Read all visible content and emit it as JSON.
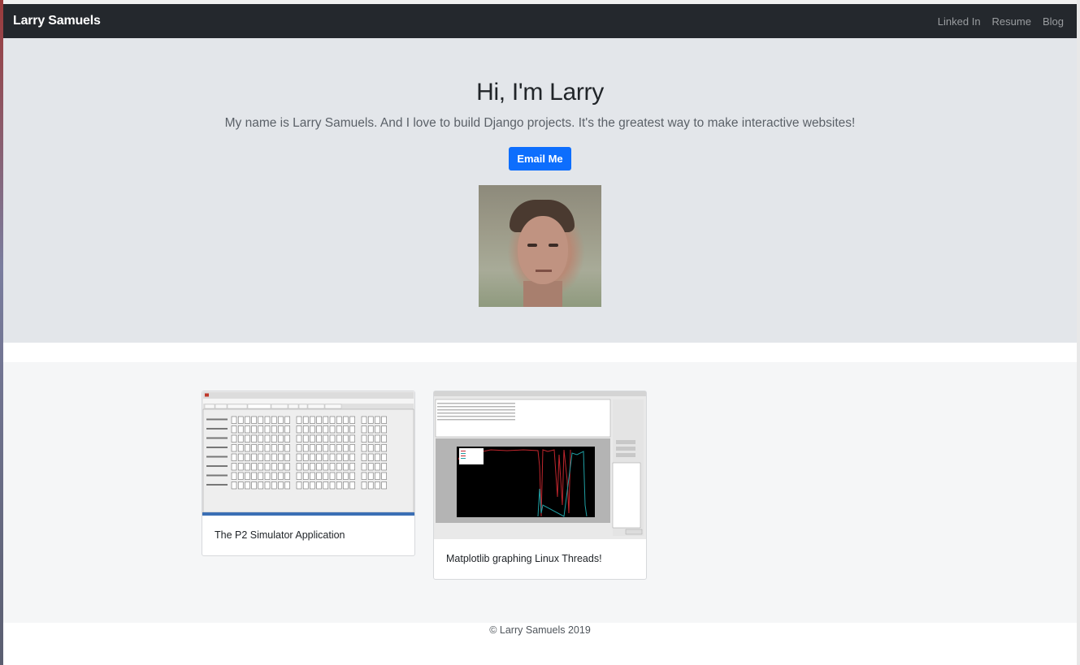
{
  "navbar": {
    "brand": "Larry Samuels",
    "links": [
      "Linked In",
      "Resume",
      "Blog"
    ]
  },
  "hero": {
    "heading": "Hi, I'm Larry",
    "lead": "My name is Larry Samuels. And I love to build Django projects. It's the greatest way to make interactive websites!",
    "button_label": "Email Me"
  },
  "projects": [
    {
      "title": "The P2 Simulator Application"
    },
    {
      "title": "Matplotlib graphing Linux Threads!"
    }
  ],
  "footer": {
    "text": "© Larry Samuels 2019"
  },
  "colors": {
    "navbar": "#24282d",
    "hero_bg": "#e3e6ea",
    "button": "#0d6efd",
    "projects_bg": "#f5f6f7"
  }
}
